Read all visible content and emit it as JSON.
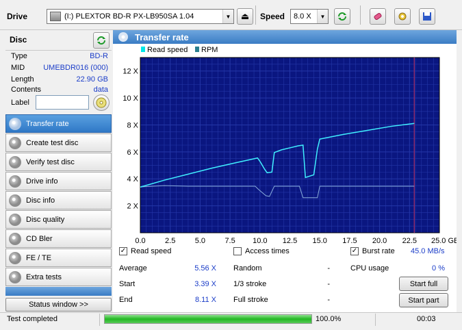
{
  "toolbar": {
    "drive_label": "Drive",
    "drive_value": "(I:)   PLEXTOR BD-R  PX-LB950SA 1.04",
    "speed_label": "Speed",
    "speed_value": "8.0 X"
  },
  "disc": {
    "title": "Disc",
    "rows": [
      {
        "key": "Type",
        "value": "BD-R"
      },
      {
        "key": "MID",
        "value": "UMEBDR016 (000)"
      },
      {
        "key": "Length",
        "value": "22.90 GB"
      },
      {
        "key": "Contents",
        "value": "data"
      }
    ],
    "label_key": "Label",
    "label_value": ""
  },
  "nav": [
    {
      "label": "Transfer rate",
      "active": true
    },
    {
      "label": "Create test disc"
    },
    {
      "label": "Verify test disc"
    },
    {
      "label": "Drive info"
    },
    {
      "label": "Disc info"
    },
    {
      "label": "Disc quality"
    },
    {
      "label": "CD Bler"
    },
    {
      "label": "FE / TE"
    },
    {
      "label": "Extra tests"
    }
  ],
  "status_window_button": "Status window >>",
  "panel_title": "Transfer rate",
  "chart_data": {
    "type": "line",
    "legend": [
      "Read speed",
      "RPM"
    ],
    "legend_placement": "top-left",
    "xlabel": "",
    "ylabel": "",
    "x_ticks": [
      "0.0",
      "2.5",
      "5.0",
      "7.5",
      "10.0",
      "12.5",
      "15.0",
      "17.5",
      "20.0",
      "22.5",
      "25.0 GB"
    ],
    "y_ticks": [
      "2 X",
      "4 X",
      "6 X",
      "8 X",
      "10 X",
      "12 X"
    ],
    "xlim": [
      0,
      25
    ],
    "ylim": [
      0,
      13
    ],
    "grid": true,
    "marker_x": 22.9,
    "series": [
      {
        "name": "Read speed",
        "color": "#40f0ff",
        "x": [
          0,
          2,
          4,
          6,
          8,
          9.8,
          10,
          10.4,
          10.6,
          11,
          11.2,
          11.8,
          12.5,
          13.2,
          13.6,
          13.8,
          14.5,
          14.8,
          15,
          17,
          19,
          21,
          22.9
        ],
        "y": [
          3.39,
          3.9,
          4.35,
          4.8,
          5.2,
          5.55,
          5.3,
          4.7,
          4.45,
          4.5,
          5.95,
          6.15,
          6.3,
          6.45,
          6.5,
          4.1,
          4.3,
          6.2,
          6.95,
          7.3,
          7.6,
          7.9,
          8.11
        ]
      },
      {
        "name": "RPM",
        "color": "#8aaedc",
        "x": [
          0,
          2,
          4,
          8,
          9.6,
          9.9,
          10.5,
          10.8,
          11.2,
          13.3,
          13.6,
          14.8,
          15,
          22.9
        ],
        "y": [
          3.4,
          3.5,
          3.45,
          3.45,
          3.45,
          3.2,
          2.75,
          2.7,
          3.45,
          3.45,
          2.6,
          2.6,
          3.45,
          3.45
        ]
      }
    ]
  },
  "stats": {
    "read_speed_label": "Read speed",
    "access_times_label": "Access times",
    "burst_rate_label": "Burst rate",
    "burst_rate_value": "45.0 MB/s",
    "average_label": "Average",
    "average_value": "5.56 X",
    "start_label": "Start",
    "start_value": "3.39 X",
    "end_label": "End",
    "end_value": "8.11 X",
    "random_label": "Random",
    "random_value": "-",
    "one_third_label": "1/3 stroke",
    "one_third_value": "-",
    "full_stroke_label": "Full stroke",
    "full_stroke_value": "-",
    "cpu_label": "CPU usage",
    "cpu_value": "0 %",
    "start_full_button": "Start full",
    "start_part_button": "Start part"
  },
  "status": {
    "text": "Test completed",
    "progress": 100,
    "progress_text": "100.0%",
    "time": "00:03"
  }
}
